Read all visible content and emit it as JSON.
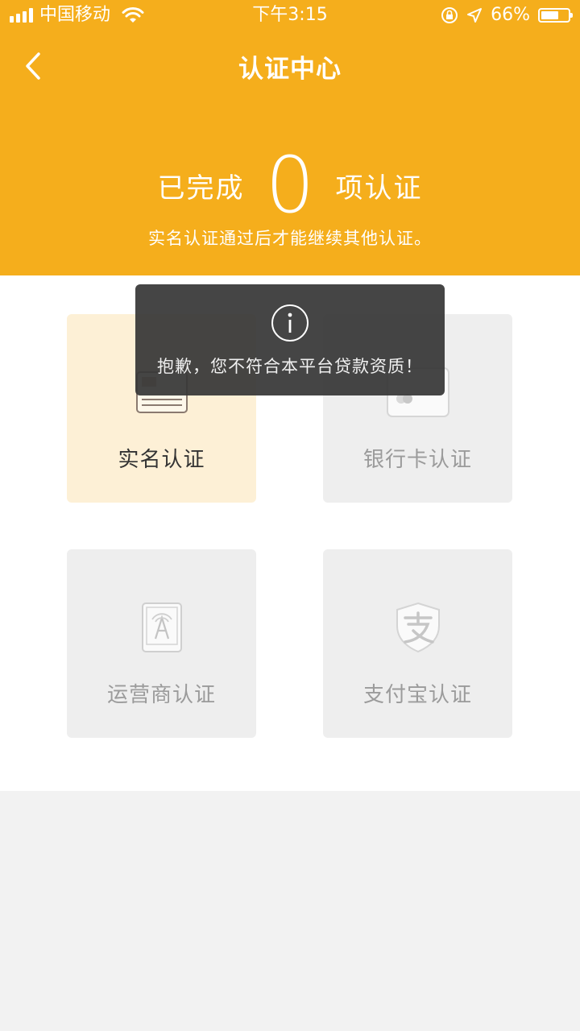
{
  "status_bar": {
    "carrier": "中国移动",
    "time": "下午3:15",
    "battery": "66%",
    "battery_level": 0.66
  },
  "nav": {
    "title": "认证中心"
  },
  "progress": {
    "prefix": "已完成",
    "count": "0",
    "suffix": "项认证",
    "hint": "实名认证通过后才能继续其他认证。"
  },
  "tiles": [
    {
      "label": "实名认证",
      "icon": "id-card-icon",
      "active": true
    },
    {
      "label": "银行卡认证",
      "icon": "bank-card-icon",
      "active": false
    },
    {
      "label": "运营商认证",
      "icon": "mobile-operator-icon",
      "active": false
    },
    {
      "label": "支付宝认证",
      "icon": "alipay-icon",
      "active": false
    }
  ],
  "toast": {
    "icon": "info-icon",
    "message": "抱歉，您不符合本平台贷款资质！"
  },
  "colors": {
    "brand": "#f5ae1c",
    "active_tile": "#fdf0d6",
    "inactive_tile": "#eeeeee"
  }
}
